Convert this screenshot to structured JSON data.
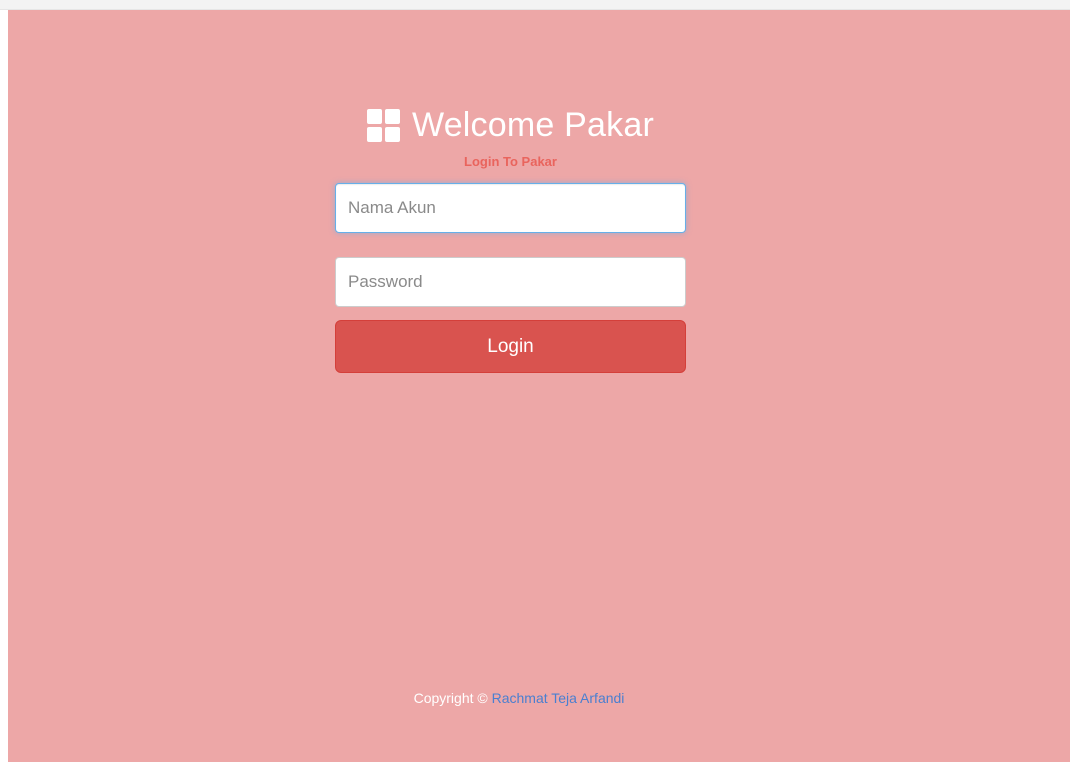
{
  "brand": {
    "icon": "windows-grid-icon",
    "title": "Welcome Pakar"
  },
  "subtitle": "Login To Pakar",
  "form": {
    "username_placeholder": "Nama Akun",
    "username_value": "",
    "password_placeholder": "Password",
    "password_value": "",
    "login_label": "Login"
  },
  "footer": {
    "prefix": "Copyright © ",
    "author": "Rachmat Teja Arfandi"
  },
  "colors": {
    "background": "#eda7a7",
    "accent": "#d9534f",
    "subtitle": "#e9645d",
    "link": "#4a7fd0"
  }
}
